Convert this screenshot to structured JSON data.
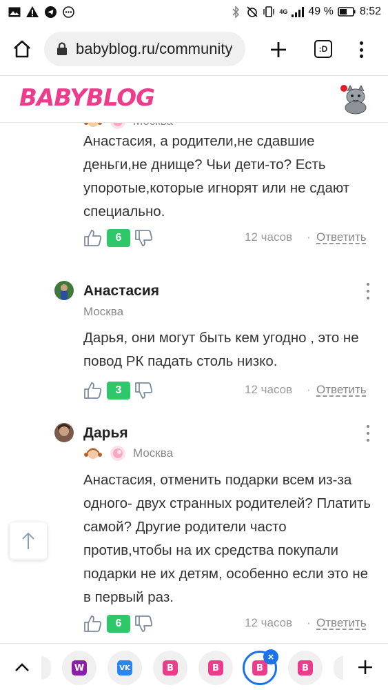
{
  "status_bar": {
    "battery_percent": "49 %",
    "time": "8:52",
    "network": "4G"
  },
  "browser": {
    "url": "babyblog.ru/community",
    "tabs_label": ":D"
  },
  "site": {
    "logo_text": "BABYBLOG"
  },
  "comments": [
    {
      "author": "",
      "city": "Москва",
      "text": "Анастасия, а родители,не сдавшие деньги,не днище? Чьи дети-то? Есть упоротые,которые игнорят или не сдают специально.",
      "score": "6",
      "time": "12 часов",
      "reply_label": "Ответить"
    },
    {
      "author": "Анастасия",
      "city": "Москва",
      "text": "Дарья, они могут быть кем угодно , это не повод РК падать столь низко.",
      "score": "3",
      "time": "12 часов",
      "reply_label": "Ответить"
    },
    {
      "author": "Дарья",
      "city": "Москва",
      "text": "Анастасия, отменить подарки всем из-за одного- двух странных родителей? Платить самой? Другие родители часто против,чтобы на их средства покупали подарки не их детям, особенно если это не в первый раз.",
      "score": "6",
      "time": "12 часов",
      "reply_label": "Ответить"
    }
  ],
  "separator": "·",
  "colors": {
    "brand_pink": "#ec3d8c",
    "score_green": "#2ec86b",
    "active_tab_blue": "#1a73e8"
  },
  "bottom_tabs": [
    {
      "icon": "wildberries-icon",
      "letter": "W",
      "color": "#8a1ea8"
    },
    {
      "icon": "vk-icon",
      "letter": "VK",
      "color": "#2787f5"
    },
    {
      "icon": "babyblog-icon",
      "letter": "B",
      "color": "#ec3d8c"
    },
    {
      "icon": "babyblog-icon",
      "letter": "B",
      "color": "#ec3d8c"
    },
    {
      "icon": "babyblog-icon",
      "letter": "B",
      "color": "#ec3d8c",
      "active": true
    },
    {
      "icon": "babyblog-icon",
      "letter": "B",
      "color": "#ec3d8c"
    }
  ]
}
